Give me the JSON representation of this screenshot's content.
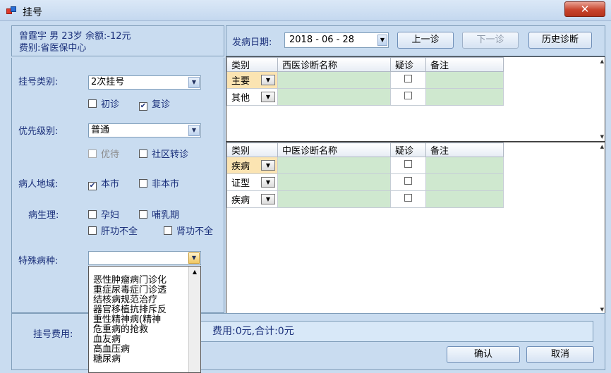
{
  "window": {
    "title": "挂号",
    "close_glyph": "✕"
  },
  "patient": {
    "line1": "曾霆宇 男 23岁 余额:-12元",
    "line2": "费别:省医保中心"
  },
  "form": {
    "register_type_label": "挂号类别:",
    "register_type_value": "2次挂号",
    "first_visit": "初诊",
    "return_visit": "复诊",
    "first_visit_checked": false,
    "return_visit_checked": true,
    "priority_label": "优先级别:",
    "priority_value": "普通",
    "priority_care": "优待",
    "community_transfer": "社区转诊",
    "region_label": "病人地域:",
    "local": "本市",
    "nonlocal": "非本市",
    "local_checked": true,
    "physiology_label": "病生理:",
    "pregnant": "孕妇",
    "lactation": "哺乳期",
    "liver_insufficiency": "肝功不全",
    "kidney_insufficiency": "肾功不全",
    "special_disease_label": "特殊病种:",
    "special_disease_value": ""
  },
  "special_disease_options": [
    "恶性肿瘤病门诊化",
    "重症尿毒症门诊透",
    "结核病规范治疗",
    "器官移植抗排斥反",
    "重性精神病(精神",
    "危重病的抢救",
    "血友病",
    "高血压病",
    "糖尿病"
  ],
  "toolbar": {
    "date_label": "发病日期:",
    "date_value": "2018 - 06 - 28",
    "prev_visit": "上一诊",
    "next_visit": "下一诊",
    "history": "历史诊断"
  },
  "western_grid": {
    "headers": [
      "类别",
      "西医诊断名称",
      "疑诊",
      "备注"
    ],
    "rows": [
      {
        "category": "主要"
      },
      {
        "category": "其他"
      }
    ]
  },
  "tcm_grid": {
    "headers": [
      "类别",
      "中医诊断名称",
      "疑诊",
      "备注"
    ],
    "rows": [
      {
        "category": "疾病"
      },
      {
        "category": "证型"
      },
      {
        "category": "疾病"
      }
    ]
  },
  "fee": {
    "label": "挂号费用:",
    "summary": "费用:0元,合计:0元"
  },
  "actions": {
    "confirm": "确认",
    "cancel": "取消"
  },
  "icons": {
    "dropdown_arrow": "▼",
    "scroll_up": "▲",
    "scroll_down": "▼",
    "check_mark": "✔"
  }
}
